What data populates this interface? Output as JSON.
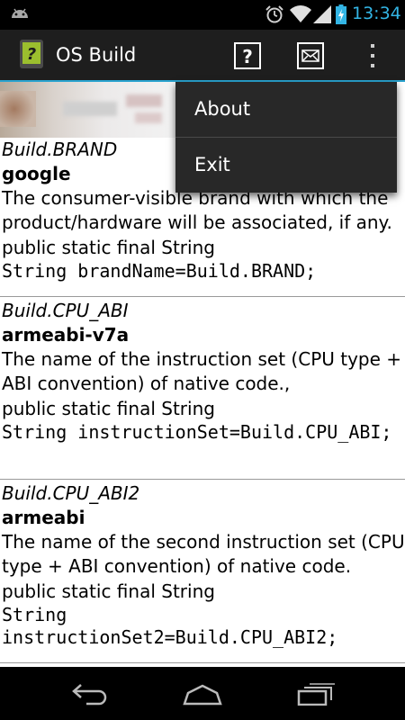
{
  "status_bar": {
    "time": "13:34",
    "icons": [
      "android-icon",
      "alarm-icon",
      "wifi-icon",
      "signal-icon",
      "battery-icon"
    ]
  },
  "action_bar": {
    "title": "OS Build",
    "help_icon": "question-icon",
    "mail_icon": "mail-icon",
    "overflow_icon": "overflow-menu-icon"
  },
  "menu": {
    "items": [
      {
        "label": "About"
      },
      {
        "label": "Exit"
      }
    ]
  },
  "entries": [
    {
      "name": "Build.BRAND",
      "value": "google",
      "description": "The consumer-visible brand with which the product/hardware will be associated, if any.",
      "declaration": "public static final String",
      "code": "String brandName=Build.BRAND;"
    },
    {
      "name": "Build.CPU_ABI",
      "value": "armeabi-v7a",
      "description": "The name of the instruction set (CPU type + ABI convention) of native code.,",
      "declaration": "public static final String",
      "code": "String instructionSet=Build.CPU_ABI;"
    },
    {
      "name": "Build.CPU_ABI2",
      "value": "armeabi",
      "description": "The name of the second instruction set (CPU type + ABI convention) of native code.",
      "declaration": "public static final String",
      "code": "String instructionSet2=Build.CPU_ABI2;"
    }
  ],
  "colors": {
    "accent": "#33b5e5",
    "actionbar": "#1e1e1e",
    "menu": "#282828"
  }
}
